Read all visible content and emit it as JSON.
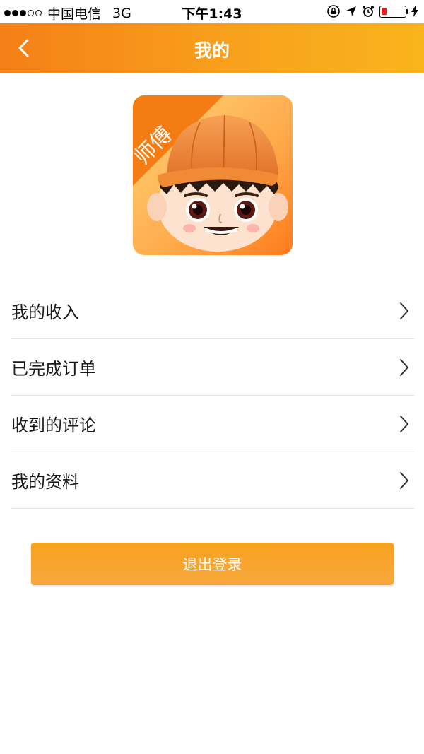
{
  "status_bar": {
    "carrier": "中国电信",
    "network": "3G",
    "time": "下午1:43"
  },
  "nav": {
    "title": "我的",
    "back_icon": "chevron-left-icon"
  },
  "avatar": {
    "badge_text": "师傅"
  },
  "menu": {
    "items": [
      {
        "label": "我的收入"
      },
      {
        "label": "已完成订单"
      },
      {
        "label": "收到的评论"
      },
      {
        "label": "我的资料"
      }
    ]
  },
  "logout": {
    "label": "退出登录"
  },
  "colors": {
    "accent": "#f8a11c",
    "battery_low": "#e02020"
  }
}
